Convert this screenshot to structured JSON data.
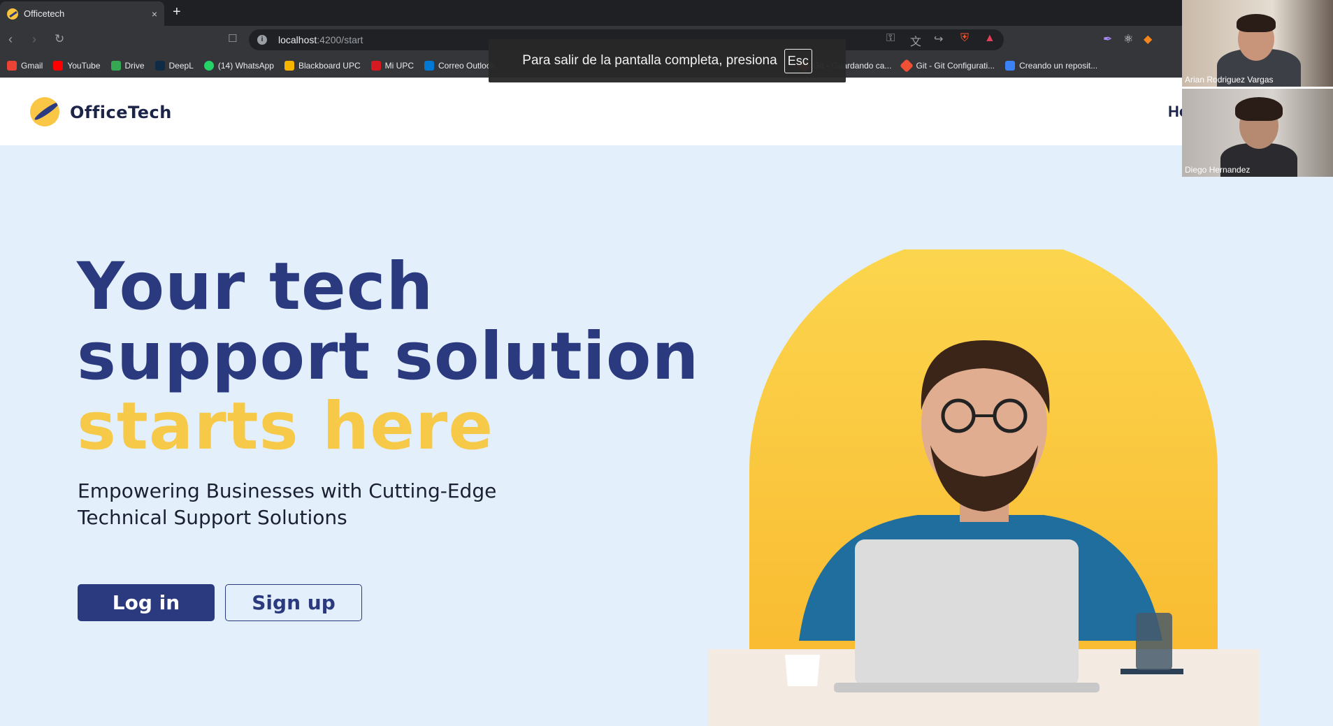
{
  "browser": {
    "tab": {
      "title": "Officetech",
      "close": "×"
    },
    "new_tab": "+",
    "url": {
      "host": "localhost",
      "path": ":4200/start"
    },
    "bookmarks": [
      {
        "label": "Gmail",
        "color": "#ea4335"
      },
      {
        "label": "YouTube",
        "color": "#ff0000"
      },
      {
        "label": "Drive",
        "color": "#34a853"
      },
      {
        "label": "DeepL",
        "color": "#0f2b46"
      },
      {
        "label": "(14) WhatsApp",
        "color": "#25d366"
      },
      {
        "label": "Blackboard UPC",
        "color": "#f4b400"
      },
      {
        "label": "Mi UPC",
        "color": "#d71920"
      },
      {
        "label": "Correo Outlook",
        "color": "#0078d4"
      },
      {
        "label": "Git - Guardando ca...",
        "color": "#f05033"
      },
      {
        "label": "Git - Git Configurati...",
        "color": "#f05033"
      },
      {
        "label": "Creando un reposit...",
        "color": "#3b82f6"
      }
    ]
  },
  "fullscreen_toast": {
    "message": "Para salir de la pantalla completa, presiona",
    "key": "Esc"
  },
  "site": {
    "brand": "OfficeTech",
    "nav_home": "Home",
    "hero": {
      "line1": "Your tech",
      "line2": "support solution",
      "line3": "starts here",
      "subtitle": "Empowering Businesses with Cutting-Edge Technical Support Solutions",
      "login_label": "Log in",
      "signup_label": "Sign up"
    },
    "colors": {
      "primary": "#2b3a7f",
      "accent": "#f7c949",
      "background": "#e3f0fb"
    }
  },
  "meeting": {
    "participants": [
      {
        "name": "Arian Rodriguez Vargas"
      },
      {
        "name": "Diego Hernandez"
      }
    ]
  }
}
